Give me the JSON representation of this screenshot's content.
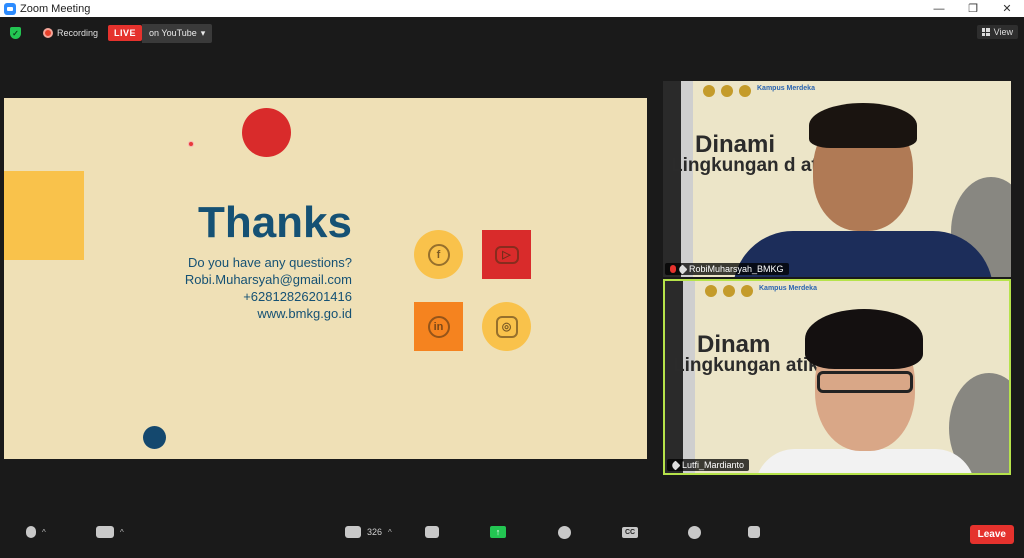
{
  "window": {
    "title": "Zoom Meeting"
  },
  "topbar": {
    "recording_label": "Recording",
    "live_badge": "LIVE",
    "stream_target": "on YouTube",
    "view_label": "View"
  },
  "slide": {
    "heading": "Thanks",
    "lines": [
      "Do you have any questions?",
      "Robi.Muharsyah@gmail.com",
      "+62812826201416",
      "www.bmkg.go.id"
    ],
    "social_icons": [
      "facebook-icon",
      "youtube-icon",
      "linkedin-icon",
      "instagram-icon"
    ],
    "colors": {
      "background": "#efe0b6",
      "accent_yellow": "#f9c24b",
      "accent_red": "#d92b2b",
      "accent_orange": "#f5831f",
      "text_blue": "#155174"
    }
  },
  "participants": [
    {
      "name": "RobiMuharsyah_BMKG",
      "muted": true,
      "pinned": true,
      "banner_line1": "Dinami",
      "banner_line2": "Lingkungan d        atika"
    },
    {
      "name": "Lutfi_Mardianto",
      "muted": false,
      "pinned": true,
      "active_speaker": true,
      "banner_line1": "Dinam",
      "banner_line2": "Lingkungan         atika"
    }
  ],
  "tile_logos": {
    "brand": "Kampus Merdeka"
  },
  "toolbar": {
    "participant_count": "326",
    "leave_label": "Leave",
    "cc_label": "CC"
  }
}
